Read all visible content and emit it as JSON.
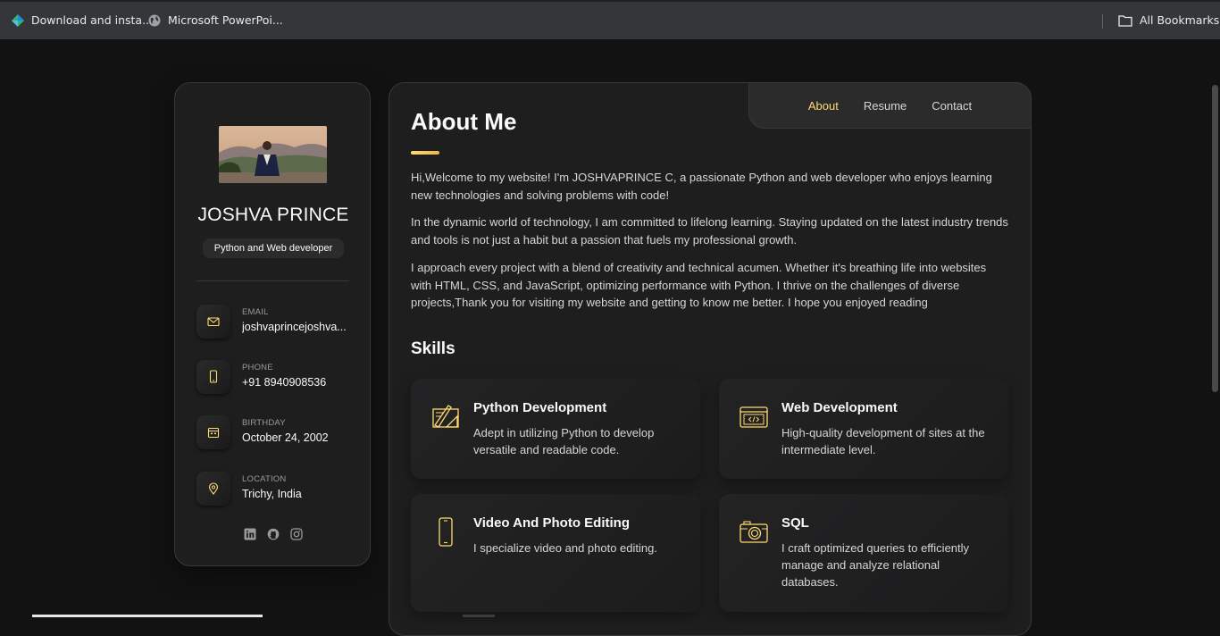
{
  "browser": {
    "bookmarks": [
      {
        "label": "Download and insta...",
        "icon": "diamond-app-icon"
      },
      {
        "label": "Microsoft PowerPoi...",
        "icon": "globe-icon"
      }
    ],
    "all_bookmarks": "All Bookmarks"
  },
  "profile": {
    "name": "JOSHVA PRINCE",
    "title": "Python and Web developer",
    "contacts": [
      {
        "label": "EMAIL",
        "value": "joshvaprincejoshva...",
        "icon": "mail-icon"
      },
      {
        "label": "PHONE",
        "value": "+91 8940908536",
        "icon": "phone-icon"
      },
      {
        "label": "BIRTHDAY",
        "value": "October 24, 2002",
        "icon": "calendar-icon"
      },
      {
        "label": "LOCATION",
        "value": "Trichy, India",
        "icon": "location-pin-icon"
      }
    ],
    "socials": [
      "linkedin-icon",
      "github-icon",
      "instagram-icon"
    ]
  },
  "nav": {
    "about": "About",
    "resume": "Resume",
    "contact": "Contact",
    "active": "About"
  },
  "about": {
    "heading": "About Me",
    "paragraphs": [
      "Hi,Welcome to my website! I'm JOSHVAPRINCE C, a passionate Python and web developer who enjoys learning new technologies and solving problems with code!",
      "In the dynamic world of technology, I am committed to lifelong learning. Staying updated on the latest industry trends and tools is not just a habit but a passion that fuels my professional growth.",
      "I approach every project with a blend of creativity and technical acumen. Whether it's breathing life into websites with HTML, CSS, and JavaScript, optimizing performance with Python. I thrive on the challenges of diverse projects,Thank you for visiting my website and getting to know me better. I hope you enjoyed reading"
    ]
  },
  "skills": {
    "heading": "Skills",
    "items": [
      {
        "title": "Python Development",
        "desc": "Adept in utilizing Python to develop versatile and readable code.",
        "icon": "design-tools-icon"
      },
      {
        "title": "Web Development",
        "desc": "High-quality development of sites at the intermediate level.",
        "icon": "code-window-icon"
      },
      {
        "title": "Video And Photo Editing",
        "desc": "I specialize video and photo editing.",
        "icon": "smartphone-icon"
      },
      {
        "title": "SQL",
        "desc": "I craft optimized queries to efficiently manage and analyze relational databases.",
        "icon": "camera-icon"
      }
    ]
  },
  "colors": {
    "accent": "#ffdb70",
    "background": "#121212",
    "card": "#1e1e1f"
  }
}
